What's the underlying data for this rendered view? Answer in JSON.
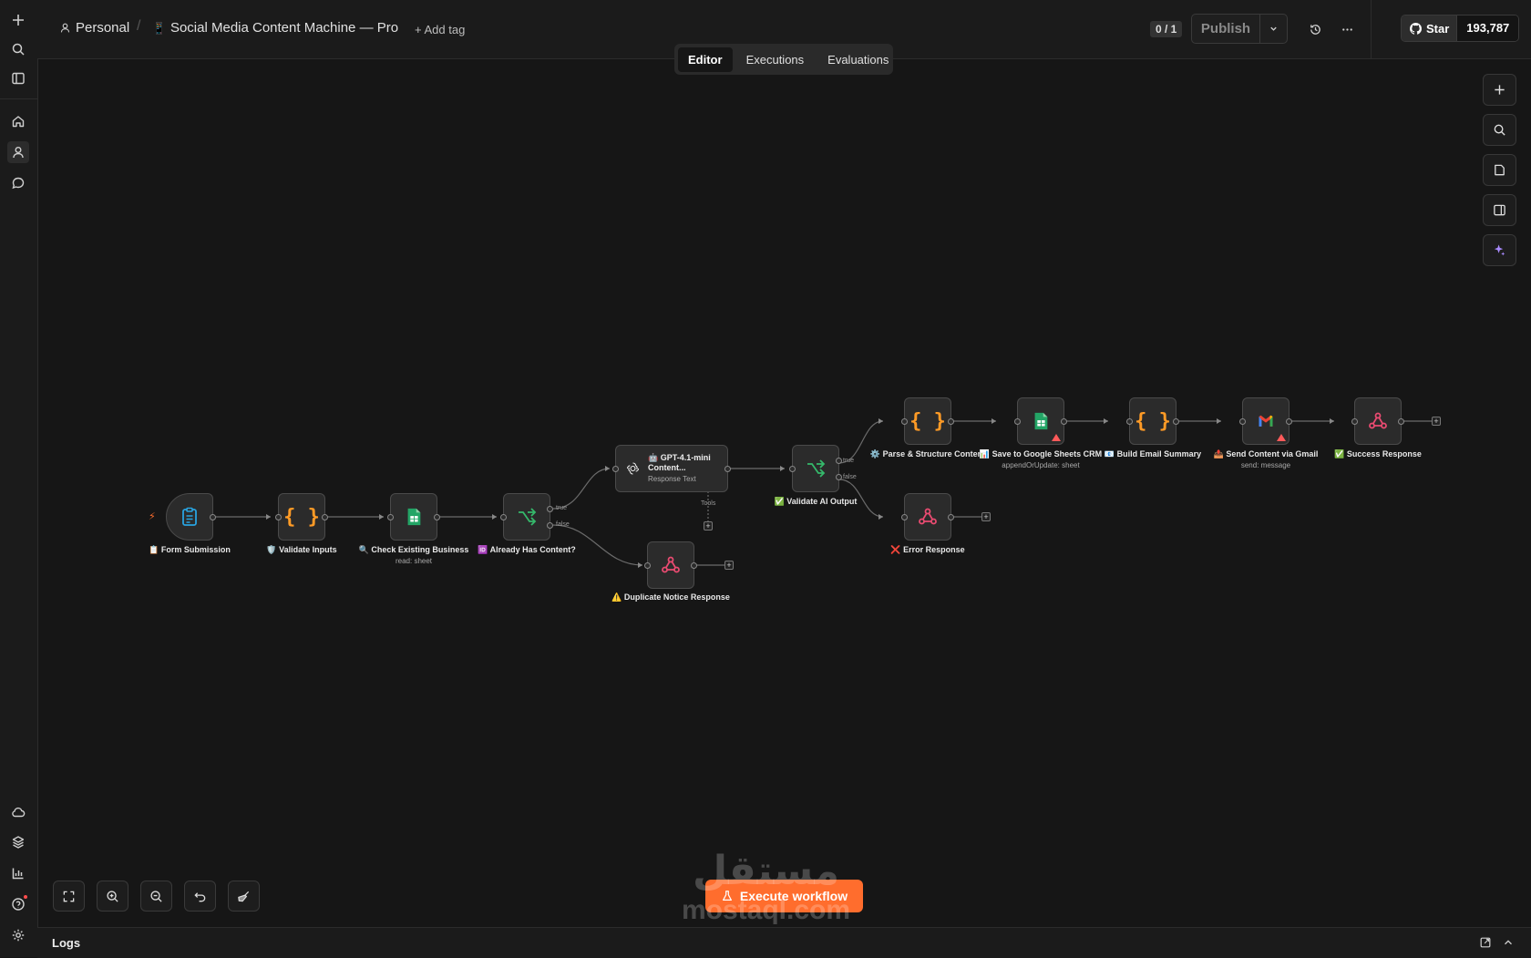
{
  "header": {
    "project": "Personal",
    "workflow_name": "Social Media Content Machine — Pro",
    "add_tag": "+ Add tag",
    "version_badge": "0 / 1",
    "publish_label": "Publish",
    "github_star_label": "Star",
    "github_star_count": "193,787"
  },
  "tabs": [
    {
      "label": "Editor",
      "active": true
    },
    {
      "label": "Executions",
      "active": false
    },
    {
      "label": "Evaluations",
      "active": false
    }
  ],
  "nodes": {
    "form_submission": {
      "label": "📋 Form Submission"
    },
    "validate_inputs": {
      "label": "🛡️ Validate Inputs"
    },
    "check_existing": {
      "label": "🔍 Check Existing Business",
      "sub": "read: sheet"
    },
    "already_has_content": {
      "label": "🆔 Already Has Content?"
    },
    "gpt": {
      "label": "🤖 GPT-4.1-mini Content...",
      "sub": "Response Text",
      "tools": "Tools"
    },
    "duplicate_notice": {
      "label": "⚠️ Duplicate Notice Response"
    },
    "validate_ai": {
      "label": "✅ Validate AI Output"
    },
    "error_response": {
      "label": "❌ Error Response"
    },
    "parse_structure": {
      "label": "⚙️ Parse & Structure Content"
    },
    "save_sheets": {
      "label": "📊 Save to Google Sheets CRM",
      "sub": "appendOrUpdate: sheet"
    },
    "build_email": {
      "label": "📧 Build Email Summary"
    },
    "send_gmail": {
      "label": "📤 Send Content via Gmail",
      "sub": "send: message"
    },
    "success_response": {
      "label": "✅ Success Response"
    }
  },
  "branch_labels": {
    "true": "true",
    "false": "false"
  },
  "execute_button": "Execute workflow",
  "logs_title": "Logs",
  "watermark": {
    "arabic": "مستقل",
    "latin": "mostaql.com"
  },
  "colors": {
    "accent": "#ff6d2d",
    "background": "#161616",
    "code_node": "#ff9b26",
    "sheets_green": "#23a566",
    "webhook_red": "#ea4b71",
    "if_green": "#35b96b",
    "form_blue": "#29a3e0"
  }
}
